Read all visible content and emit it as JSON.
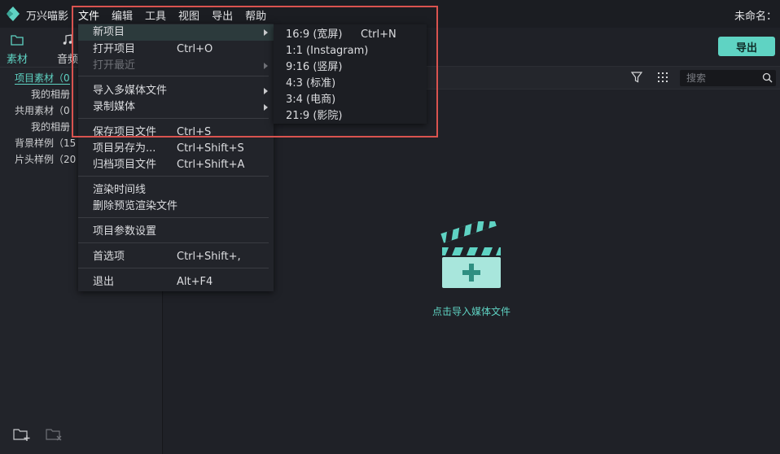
{
  "app": {
    "name": "万兴喵影",
    "doc_title": "未命名："
  },
  "menubar": [
    "文件",
    "编辑",
    "工具",
    "视图",
    "导出",
    "帮助"
  ],
  "left_tabs": [
    {
      "label": "素材",
      "icon": "folder-icon",
      "selected": true
    },
    {
      "label": "音频",
      "icon": "music-note-icon",
      "selected": false
    }
  ],
  "tree": [
    {
      "label": "项目素材（0",
      "level": 0,
      "selected": true
    },
    {
      "label": "我的相册",
      "level": 1
    },
    {
      "label": "共用素材（0",
      "level": 0
    },
    {
      "label": "我的相册",
      "level": 1
    },
    {
      "label": "背景样例（15",
      "level": 0
    },
    {
      "label": "片头样例（20",
      "level": 0
    }
  ],
  "left_bottom_icons": [
    "add-folder-icon",
    "remove-folder-icon"
  ],
  "main": {
    "export_label": "导出",
    "search_placeholder": "搜索",
    "empty_text": "点击导入媒体文件",
    "colors": {
      "accent": "#5fd3c3",
      "highlight": "#d9534f"
    }
  },
  "file_menu": {
    "items": [
      {
        "label": "新项目",
        "shortcut": "",
        "submenu": true,
        "highlighted": true
      },
      {
        "label": "打开项目",
        "shortcut": "Ctrl+O"
      },
      {
        "label": "打开最近",
        "shortcut": "",
        "submenu": true,
        "disabled": true
      },
      {
        "separator": true
      },
      {
        "label": "导入多媒体文件",
        "shortcut": "",
        "submenu": true
      },
      {
        "label": "录制媒体",
        "shortcut": "",
        "submenu": true
      },
      {
        "separator": true
      },
      {
        "label": "保存项目文件",
        "shortcut": "Ctrl+S"
      },
      {
        "label": "项目另存为...",
        "shortcut": "Ctrl+Shift+S"
      },
      {
        "label": "归档项目文件",
        "shortcut": "Ctrl+Shift+A"
      },
      {
        "separator": true
      },
      {
        "label": "渲染时间线",
        "shortcut": ""
      },
      {
        "label": "删除预览渲染文件",
        "shortcut": ""
      },
      {
        "separator": true
      },
      {
        "label": "项目参数设置",
        "shortcut": ""
      },
      {
        "separator": true
      },
      {
        "label": "首选项",
        "shortcut": "Ctrl+Shift+,"
      },
      {
        "separator": true
      },
      {
        "label": "退出",
        "shortcut": "Alt+F4"
      }
    ]
  },
  "new_project_submenu": [
    {
      "label": "16:9 (宽屏)",
      "shortcut": "Ctrl+N"
    },
    {
      "label": "1:1 (Instagram)",
      "shortcut": ""
    },
    {
      "label": "9:16 (竖屏)",
      "shortcut": ""
    },
    {
      "label": "4:3 (标准)",
      "shortcut": ""
    },
    {
      "label": "3:4 (电商)",
      "shortcut": ""
    },
    {
      "label": "21:9 (影院)",
      "shortcut": ""
    }
  ]
}
